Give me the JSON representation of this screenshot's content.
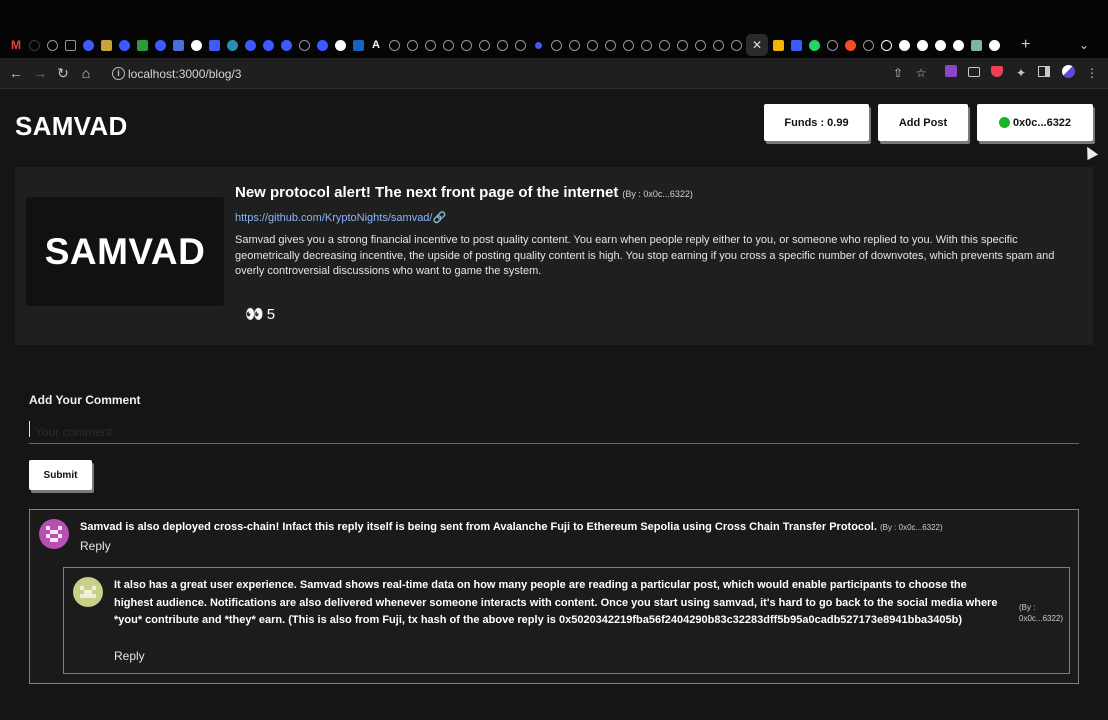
{
  "browser": {
    "url": "localhost:3000/blog/3",
    "new_tab": "+",
    "tab_menu": "⌄",
    "active_tab_close": "✕"
  },
  "header": {
    "brand": "SAMVAD",
    "funds_label": "Funds : 0.99",
    "add_post_label": "Add Post",
    "account_label": "0x0c...6322"
  },
  "post": {
    "logo_text": "SAMVAD",
    "title": "New protocol alert! The next front page of the internet",
    "author": "(By : 0x0c...6322)",
    "link": "https://github.com/KryptoNights/samvad/🔗",
    "body": "Samvad gives you a strong financial incentive to post quality content. You earn when people reply either to you, or someone who replied to you. With this specific geometrically decreasing incentive, the upside of posting quality content is high. You stop earning if you cross a specific number of downvotes, which prevents spam and overly controversial discussions who want to game the system.",
    "views_icon": "👀",
    "views": "5"
  },
  "comment_form": {
    "heading": "Add Your Comment",
    "placeholder": "Your comment",
    "value": "",
    "submit_label": "Submit"
  },
  "comments": [
    {
      "text": "Samvad is also deployed cross-chain! Infact this reply itself is being sent from Avalanche Fuji to Ethereum Sepolia using Cross Chain Transfer Protocol.",
      "author": "(By : 0x0c...6322)",
      "reply_label": "Reply",
      "replies": [
        {
          "text": "It also has a great user experience. Samvad shows real-time data on how many people are reading a particular post, which would enable participants to choose the highest audience. Notifications are also delivered whenever someone interacts with content. Once you start using samvad, it's hard to go back to the social media where *you* contribute and *they* earn. (This is also from Fuji, tx hash of the above reply is 0x5020342219fba56f2404290b83c32283dff5b95a0cadb527173e8941bba3405b)",
          "author_line1": "(By :",
          "author_line2": "0x0c...6322)",
          "reply_label": "Reply"
        }
      ]
    }
  ],
  "colors": {
    "background": "#151515",
    "card": "#1f1f1f",
    "link": "#8ab4f8",
    "online": "#19b526"
  }
}
